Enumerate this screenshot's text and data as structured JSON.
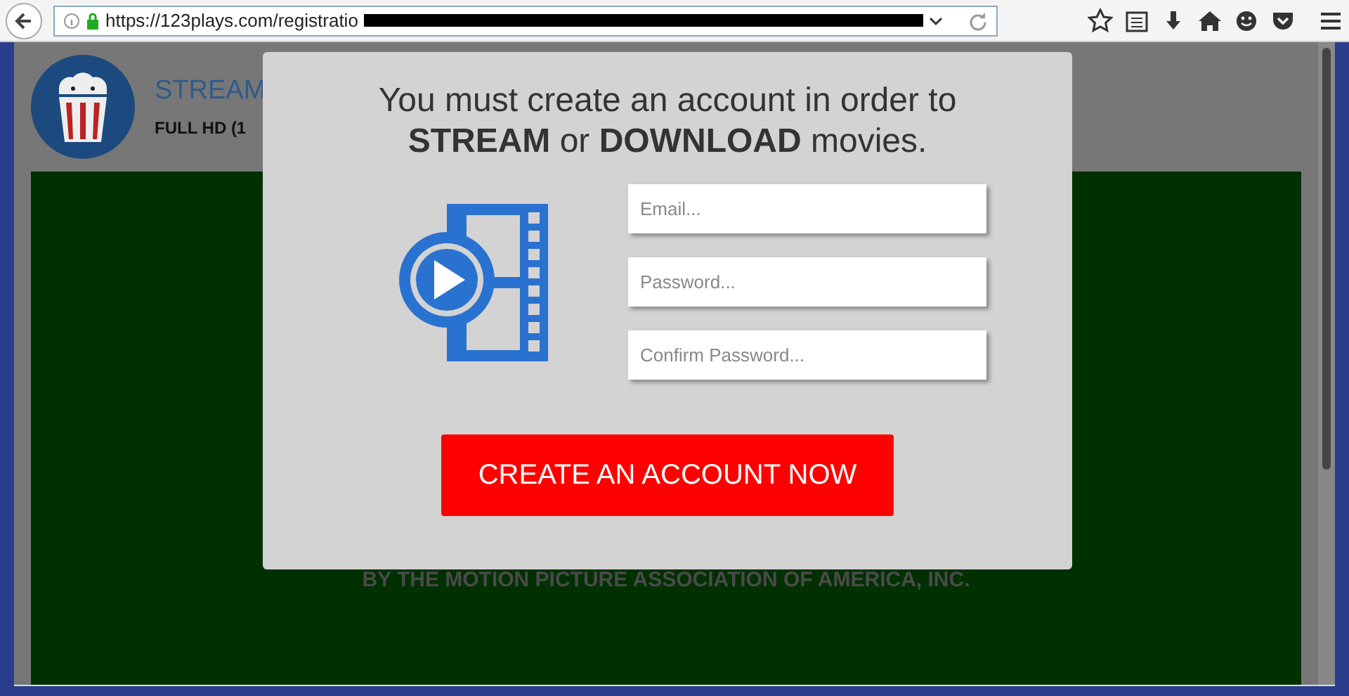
{
  "browser": {
    "url": "https://123plays.com/registratio"
  },
  "page": {
    "header_title": "STREAM",
    "header_subtitle": "FULL HD (1",
    "footer_text": "BY THE MOTION PICTURE ASSOCIATION OF AMERICA, INC."
  },
  "modal": {
    "heading_line1": "You must create an account in order to",
    "heading_line2": "**STREAM** or **DOWNLOAD** movies.",
    "fields": [
      {
        "placeholder": "Email..."
      },
      {
        "placeholder": "Password..."
      },
      {
        "placeholder": "Confirm Password..."
      }
    ],
    "button": "CREATE AN ACCOUNT NOW"
  }
}
